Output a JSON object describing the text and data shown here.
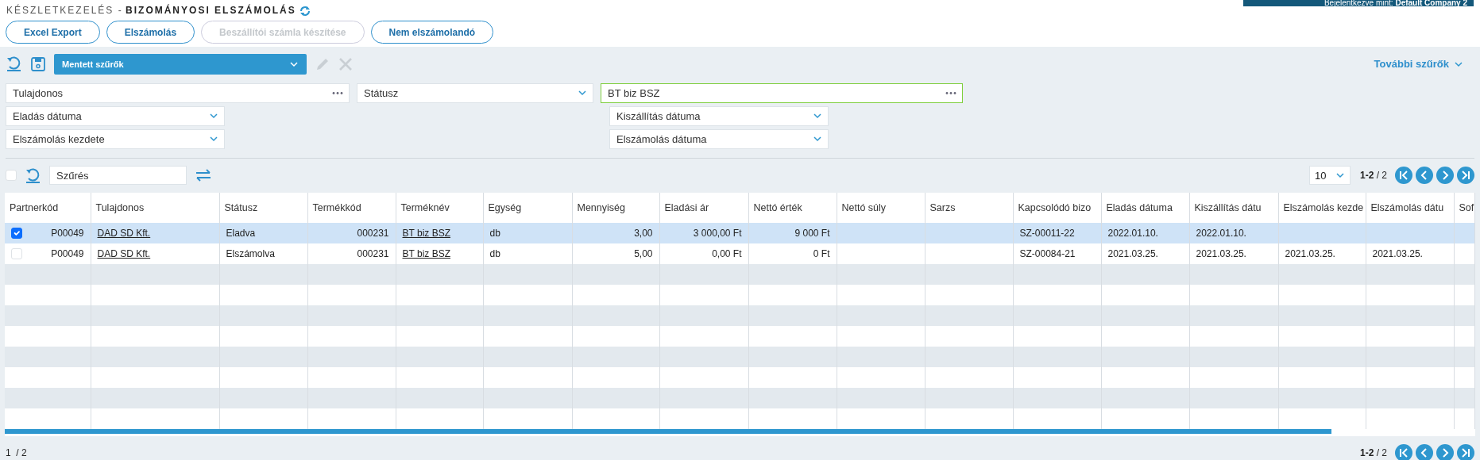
{
  "header": {
    "breadcrumb": "KÉSZLETKEZELÉS -",
    "title": "BIZOMÁNYOSI ELSZÁMOLÁS",
    "user_label": "Bejelentkezve mint:",
    "user_name": "Default Company 2"
  },
  "buttons": [
    {
      "label": "Excel Export",
      "disabled": false
    },
    {
      "label": "Elszámolás",
      "disabled": false
    },
    {
      "label": "Beszállítói számla készítése",
      "disabled": true
    },
    {
      "label": "Nem elszámolandó",
      "disabled": false
    }
  ],
  "filter_toolbar": {
    "saved_filters": "Mentett szűrők",
    "edit_disabled": true,
    "delete_disabled": true,
    "more_filters": "További szűrők"
  },
  "filters": [
    [
      {
        "kind": "lookup",
        "placeholder": "Tulajdonos",
        "highlighted": false
      },
      {
        "kind": "select",
        "placeholder": "Státusz",
        "highlighted": false
      },
      {
        "kind": "lookup",
        "value": "BT biz BSZ",
        "highlighted": true
      }
    ],
    [
      {
        "kind": "select",
        "placeholder": "Eladás dátuma",
        "highlighted": false
      },
      {
        "kind": "gap"
      },
      {
        "kind": "select",
        "placeholder": "Kiszállítás dátuma",
        "highlighted": false
      }
    ],
    [
      {
        "kind": "select",
        "placeholder": "Elszámolás kezdete",
        "highlighted": false
      },
      {
        "kind": "gap"
      },
      {
        "kind": "select",
        "placeholder": "Elszámolás dátuma",
        "highlighted": false
      }
    ]
  ],
  "table_toolbar": {
    "select_all": false,
    "search_placeholder": "Szűrés",
    "page_size": "10",
    "range": "1-2",
    "total": "/ 2"
  },
  "table": {
    "columns": [
      {
        "label": "Partnerkód",
        "kind": "check"
      },
      {
        "label": "Tulajdonos",
        "kind": "link"
      },
      {
        "label": "Státusz",
        "kind": "text"
      },
      {
        "label": "Termékkód",
        "kind": "text"
      },
      {
        "label": "Terméknév",
        "kind": "link"
      },
      {
        "label": "Egység",
        "kind": "text"
      },
      {
        "label": "Mennyiség",
        "kind": "text"
      },
      {
        "label": "Eladási ár",
        "kind": "text"
      },
      {
        "label": "Nettó érték",
        "kind": "text"
      },
      {
        "label": "Nettó súly",
        "kind": "text"
      },
      {
        "label": "Sarzs",
        "kind": "text"
      },
      {
        "label": "Kapcsolódó bizo",
        "kind": "text"
      },
      {
        "label": "Eladás dátuma",
        "kind": "text"
      },
      {
        "label": "Kiszállítás dátu",
        "kind": "text"
      },
      {
        "label": "Elszámolás kezde",
        "kind": "text"
      },
      {
        "label": "Elszámolás dátu",
        "kind": "text"
      },
      {
        "label": "Sof",
        "kind": "text"
      }
    ],
    "rows": [
      {
        "selected": true,
        "cells": [
          "P00049",
          "DAD SD Kft.",
          "Eladva",
          "000231",
          "BT biz BSZ",
          "db",
          "3,00",
          "3 000,00 Ft",
          "9 000 Ft",
          "",
          "",
          "SZ-00011-22",
          "2022.01.10.",
          "2022.01.10.",
          "",
          "",
          ""
        ]
      },
      {
        "selected": false,
        "cells": [
          "P00049",
          "DAD SD Kft.",
          "Elszámolva",
          "000231",
          "BT biz BSZ",
          "db",
          "5,00",
          "0,00 Ft",
          "0 Ft",
          "",
          "",
          "SZ-00084-21",
          "2021.03.25.",
          "2021.03.25.",
          "2021.03.25.",
          "2021.03.25.",
          ""
        ]
      }
    ]
  },
  "footer": {
    "page": "1",
    "pages": "/ 2",
    "range": "1-2",
    "total": "/ 2"
  }
}
